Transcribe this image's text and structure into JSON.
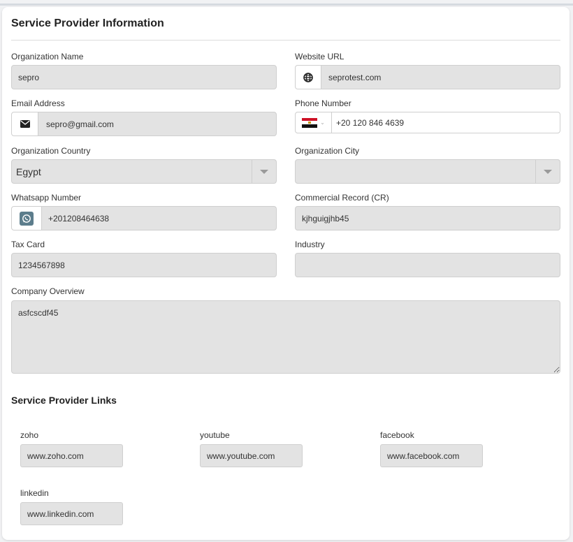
{
  "section_title": "Service Provider Information",
  "fields": {
    "org_name": {
      "label": "Organization Name",
      "value": "sepro"
    },
    "website": {
      "label": "Website URL",
      "value": "seprotest.com"
    },
    "email": {
      "label": "Email Address",
      "value": "sepro@gmail.com"
    },
    "phone": {
      "label": "Phone Number",
      "value": "+20 120 846 4639"
    },
    "country": {
      "label": "Organization Country",
      "value": "Egypt"
    },
    "city": {
      "label": "Organization City",
      "value": ""
    },
    "whatsapp": {
      "label": "Whatsapp Number",
      "value": "+201208464638"
    },
    "cr": {
      "label": "Commercial Record (CR)",
      "value": "kjhguigjhb45"
    },
    "tax": {
      "label": "Tax Card",
      "value": "1234567898"
    },
    "industry": {
      "label": "Industry",
      "value": ""
    },
    "overview": {
      "label": "Company Overview",
      "value": "asfcscdf45"
    }
  },
  "links_title": "Service Provider Links",
  "links": [
    {
      "label": "zoho",
      "value": "www.zoho.com"
    },
    {
      "label": "youtube",
      "value": "www.youtube.com"
    },
    {
      "label": "facebook",
      "value": "www.facebook.com"
    },
    {
      "label": "linkedin",
      "value": "www.linkedin.com"
    }
  ],
  "icons": {
    "website": "globe-icon",
    "email": "envelope-icon",
    "phone": "egypt-flag-icon",
    "whatsapp": "whatsapp-icon"
  },
  "colors": {
    "field_bg": "#e3e3e3",
    "whatsapp_icon_bg": "#5c7d8c"
  }
}
